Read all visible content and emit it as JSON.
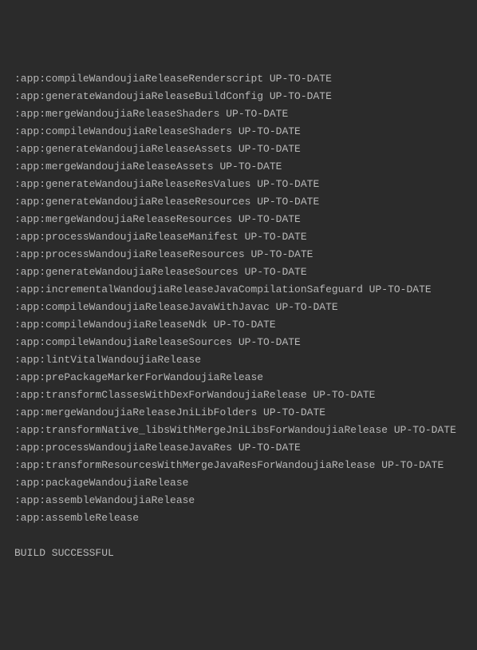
{
  "lines": [
    {
      "text": ":app:compileWandoujiaReleaseRenderscript UP-TO-DATE"
    },
    {
      "text": ":app:generateWandoujiaReleaseBuildConfig UP-TO-DATE"
    },
    {
      "text": ":app:mergeWandoujiaReleaseShaders UP-TO-DATE"
    },
    {
      "text": ":app:compileWandoujiaReleaseShaders UP-TO-DATE"
    },
    {
      "text": ":app:generateWandoujiaReleaseAssets UP-TO-DATE"
    },
    {
      "text": ":app:mergeWandoujiaReleaseAssets UP-TO-DATE"
    },
    {
      "text": ":app:generateWandoujiaReleaseResValues UP-TO-DATE"
    },
    {
      "text": ":app:generateWandoujiaReleaseResources UP-TO-DATE"
    },
    {
      "text": ":app:mergeWandoujiaReleaseResources UP-TO-DATE"
    },
    {
      "text": ":app:processWandoujiaReleaseManifest UP-TO-DATE"
    },
    {
      "text": ":app:processWandoujiaReleaseResources UP-TO-DATE"
    },
    {
      "text": ":app:generateWandoujiaReleaseSources UP-TO-DATE"
    },
    {
      "text": ":app:incrementalWandoujiaReleaseJavaCompilationSafeguard UP-TO-DATE"
    },
    {
      "text": ":app:compileWandoujiaReleaseJavaWithJavac UP-TO-DATE"
    },
    {
      "text": ":app:compileWandoujiaReleaseNdk UP-TO-DATE"
    },
    {
      "text": ":app:compileWandoujiaReleaseSources UP-TO-DATE"
    },
    {
      "text": ":app:lintVitalWandoujiaRelease"
    },
    {
      "text": ":app:prePackageMarkerForWandoujiaRelease"
    },
    {
      "text": ":app:transformClassesWithDexForWandoujiaRelease UP-TO-DATE"
    },
    {
      "text": ":app:mergeWandoujiaReleaseJniLibFolders UP-TO-DATE"
    },
    {
      "text": ":app:transformNative_libsWithMergeJniLibsForWandoujiaRelease UP-TO-DATE"
    },
    {
      "text": ":app:processWandoujiaReleaseJavaRes UP-TO-DATE"
    },
    {
      "text": ":app:transformResourcesWithMergeJavaResForWandoujiaRelease UP-TO-DATE"
    },
    {
      "text": ":app:packageWandoujiaRelease"
    },
    {
      "text": ":app:assembleWandoujiaRelease"
    },
    {
      "text": ":app:assembleRelease"
    },
    {
      "text": ""
    },
    {
      "text": "BUILD SUCCESSFUL"
    }
  ]
}
